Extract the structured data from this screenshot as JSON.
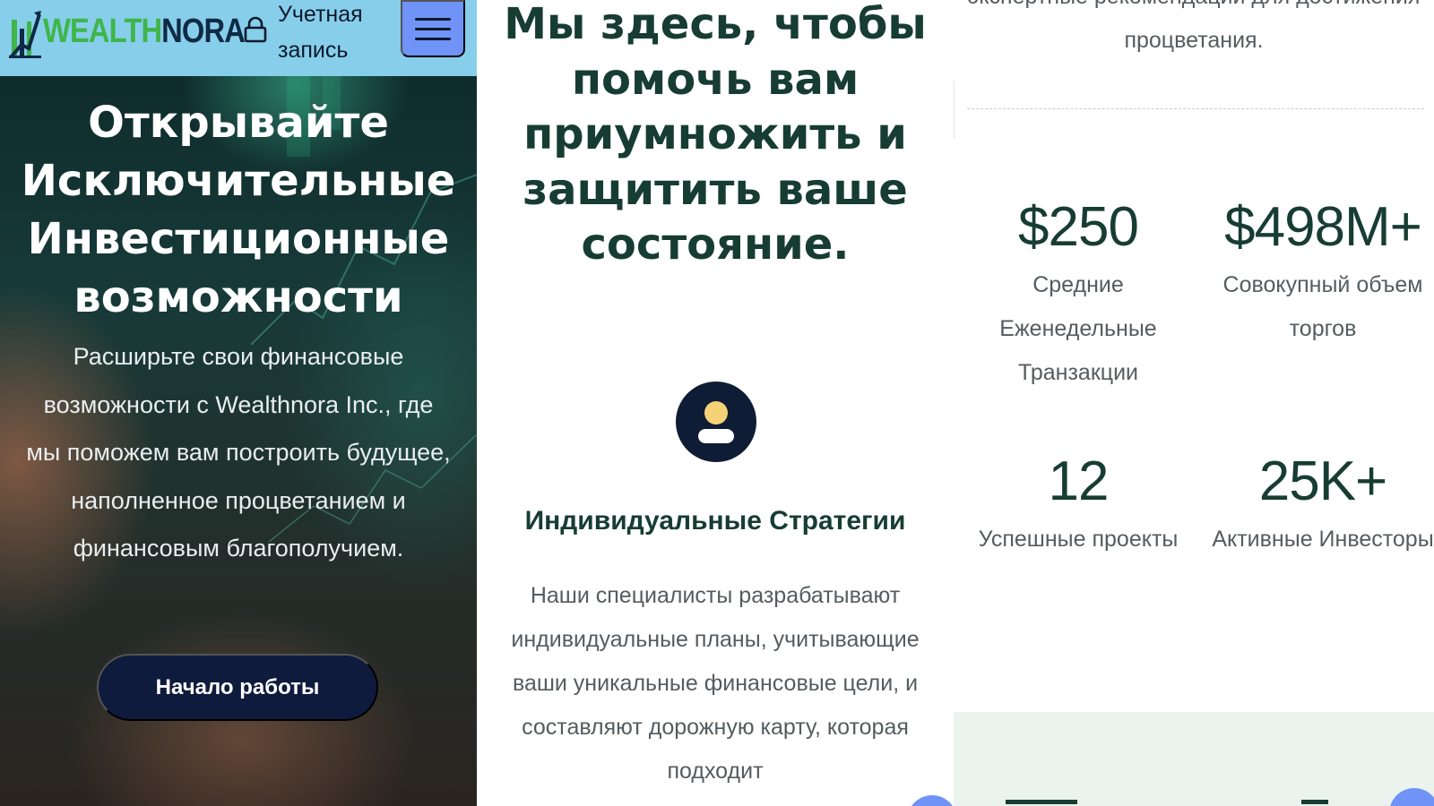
{
  "colors": {
    "topbar": "#87ceeb",
    "menu_button": "#6f93f7",
    "brand_green": "#3fb54a",
    "brand_navy": "#0f2a44",
    "heading": "#173d33",
    "cta": "#0f1b3c",
    "band": "#eaf3ee"
  },
  "header": {
    "logo": {
      "part1": "WEALTH",
      "part2": "NORA"
    },
    "account_icon": "lock-icon",
    "account_label": "Учетная запись",
    "menu_icon": "hamburger-icon"
  },
  "hero": {
    "title": "Открывайте Исключительные Инвестиционные возможности",
    "subtitle": "Расширьте свои финансовые возможности с Wealthnora Inc., где мы поможем вам построить будущее, наполненное процветанием и финансовым благополучием.",
    "cta_label": "Начало работы"
  },
  "mission": {
    "title": "Мы здесь, чтобы помочь вам приумножить и защитить ваше состояние."
  },
  "feature": {
    "icon": "user-icon",
    "title": "Индивидуальные Стратегии",
    "text": "Наши специалисты разрабатывают индивидуальные планы, учитывающие ваши уникальные финансовые цели, и составляют дорожную карту, которая подходит"
  },
  "intro": {
    "text": "экспертные рекомендации для достижения процветания."
  },
  "stats": [
    {
      "value": "$250",
      "label": "Средние Еженедельные Транзакции"
    },
    {
      "value": "$498M+",
      "label": "Совокупный объем торгов"
    },
    {
      "value": "12",
      "label": "Успешные проекты"
    },
    {
      "value": "25K+",
      "label": "Активные Инвесторы"
    }
  ]
}
